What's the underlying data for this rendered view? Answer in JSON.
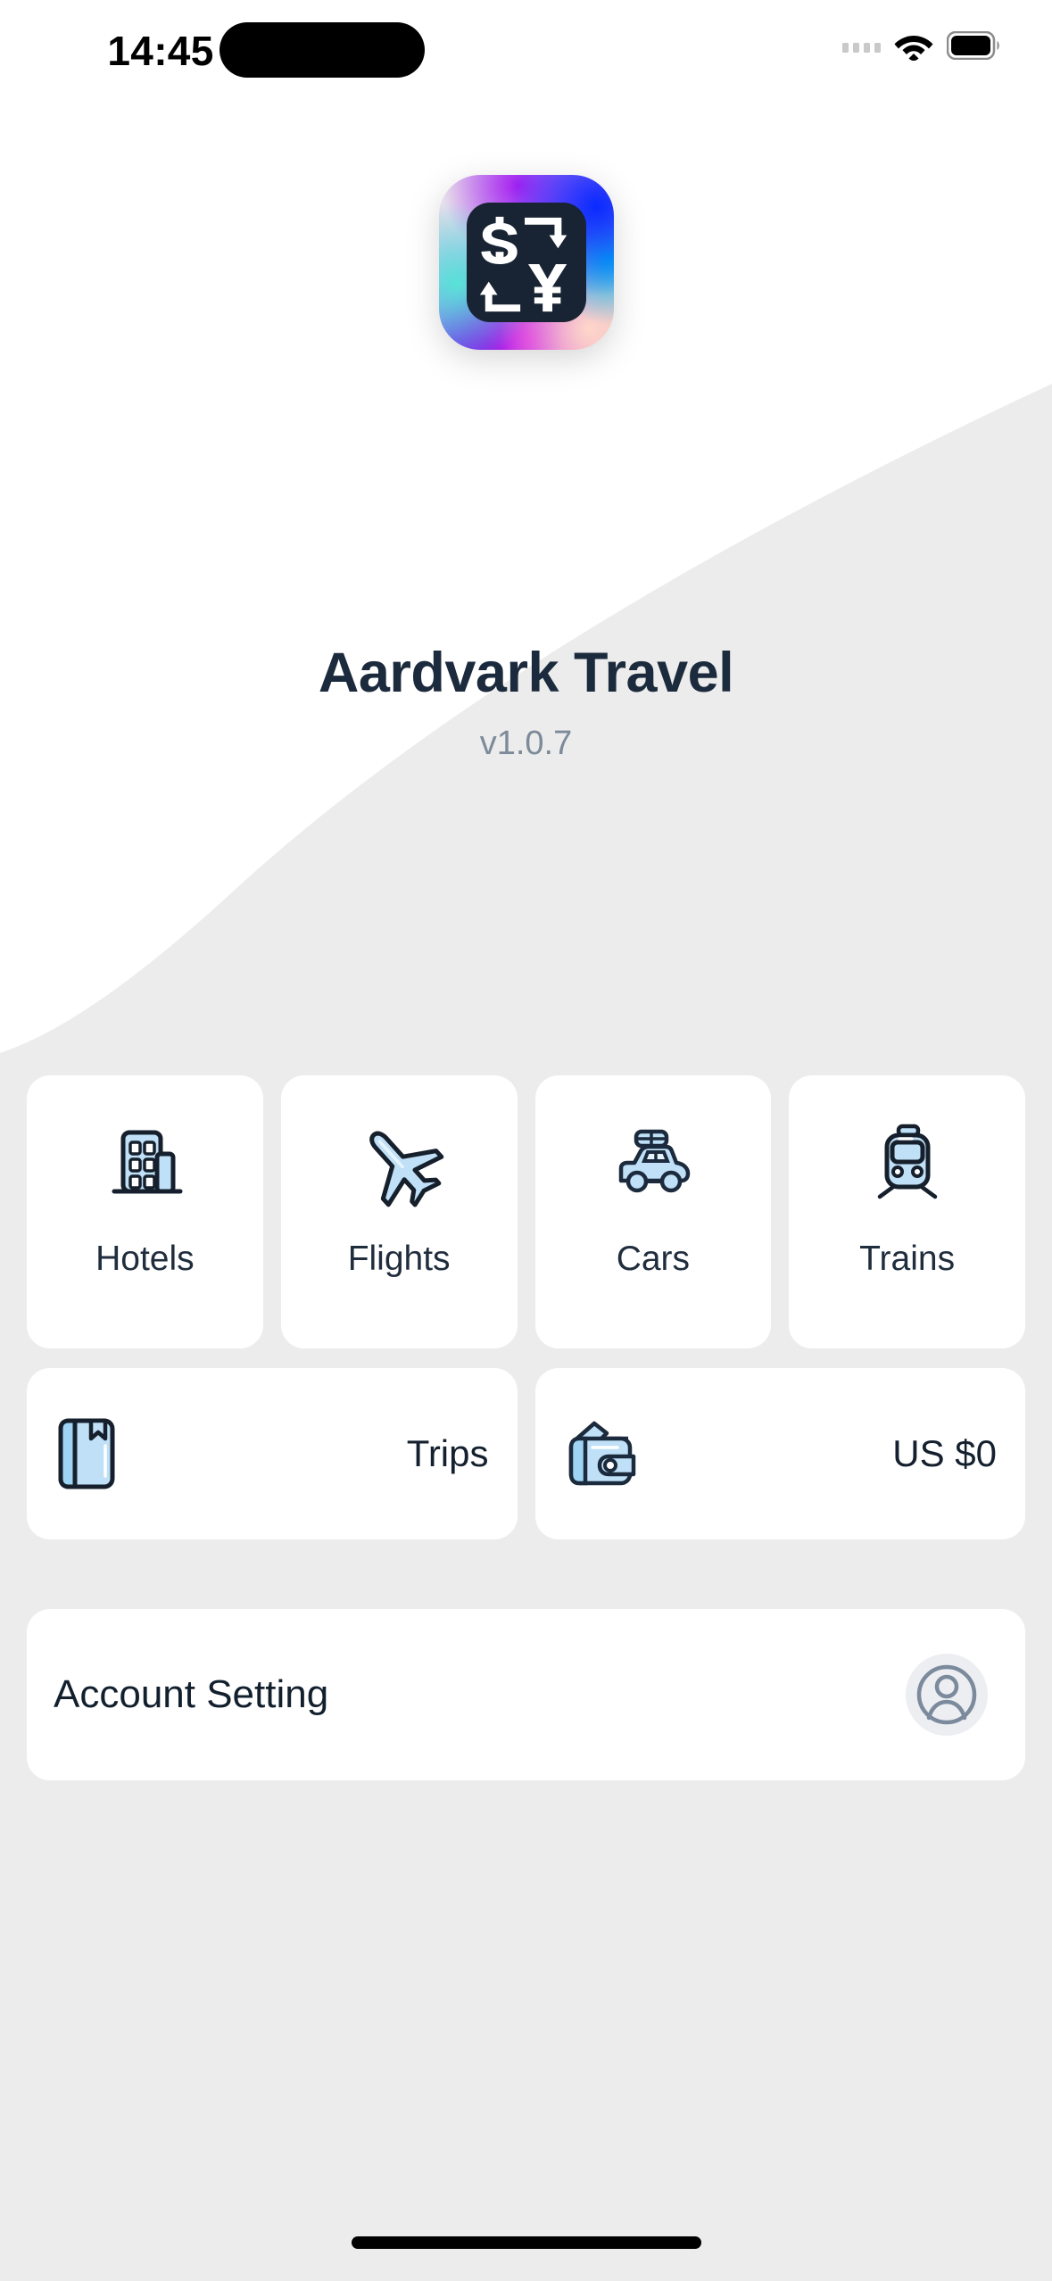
{
  "status_bar": {
    "time": "14:45",
    "signal_icon": "signal-dots-icon",
    "wifi_icon": "wifi-icon",
    "battery_icon": "battery-full-icon",
    "dynamic_island": "dynamic-island"
  },
  "app": {
    "icon_name": "currency-exchange-app-icon",
    "icon_symbols": [
      "$",
      "¥"
    ],
    "title": "Aardvark Travel",
    "version": "v1.0.7",
    "title_color": "#1b2a3c",
    "version_color": "#7d8a99"
  },
  "theme": {
    "page_background": "#ececec",
    "card_background": "#ffffff",
    "icon_fill": "#bfe0f7",
    "icon_stroke": "#16202c",
    "accent_blue": "#2aa7e0"
  },
  "tiles": [
    {
      "id": "hotels",
      "label": "Hotels",
      "icon": "hotel-building-icon"
    },
    {
      "id": "flights",
      "label": "Flights",
      "icon": "airplane-icon"
    },
    {
      "id": "cars",
      "label": "Cars",
      "icon": "car-with-roofbox-icon"
    },
    {
      "id": "trains",
      "label": "Trains",
      "icon": "tram-front-icon"
    }
  ],
  "wide_tiles": [
    {
      "id": "trips",
      "label": "Trips",
      "icon": "notebook-bookmark-icon"
    },
    {
      "id": "wallet",
      "label": "US $0",
      "icon": "wallet-icon"
    }
  ],
  "account": {
    "label": "Account Setting",
    "avatar_icon": "user-avatar-icon"
  },
  "home_indicator": "home-indicator-bar"
}
